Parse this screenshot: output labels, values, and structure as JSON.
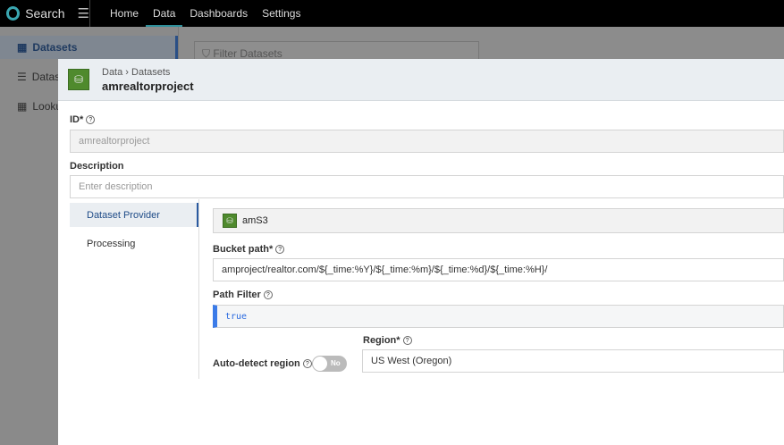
{
  "topbar": {
    "app_name": "Search",
    "nav": [
      "Home",
      "Data",
      "Dashboards",
      "Settings"
    ],
    "active_nav": "Data"
  },
  "sidebar": {
    "items": [
      {
        "label": "Datasets",
        "icon": "table-icon"
      },
      {
        "label": "Datas",
        "icon": "database-icon"
      },
      {
        "label": "Looku",
        "icon": "grid-icon"
      }
    ]
  },
  "filter": {
    "placeholder": "Filter Datasets"
  },
  "modal": {
    "breadcrumb": "Data › Datasets",
    "title": "amrealtorproject",
    "id_label": "ID*",
    "id_value": "amrealtorproject",
    "description_label": "Description",
    "description_placeholder": "Enter description",
    "tabs": [
      "Dataset Provider",
      "Processing"
    ],
    "provider": "amS3",
    "bucket_label": "Bucket path*",
    "bucket_value": "amproject/realtor.com/${_time:%Y}/${_time:%m}/${_time:%d}/${_time:%H}/",
    "path_filter_label": "Path Filter",
    "path_filter_value": "true",
    "region_label": "Region*",
    "region_value": "US West (Oregon)",
    "auto_detect_label": "Auto-detect region",
    "auto_detect_state": "No",
    "colors": {
      "accent": "#2a5aa0",
      "bucket_green": "#4f8a2d",
      "code_blue": "#3b7be8"
    }
  }
}
